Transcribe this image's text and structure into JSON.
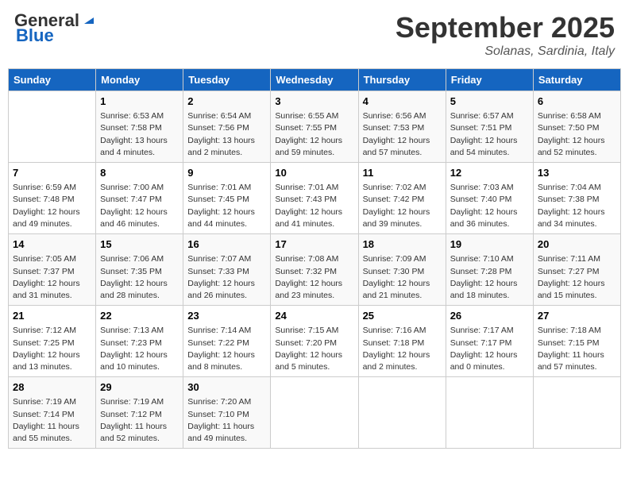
{
  "header": {
    "logo_line1": "General",
    "logo_line2": "Blue",
    "month": "September 2025",
    "location": "Solanas, Sardinia, Italy"
  },
  "weekdays": [
    "Sunday",
    "Monday",
    "Tuesday",
    "Wednesday",
    "Thursday",
    "Friday",
    "Saturday"
  ],
  "weeks": [
    [
      {
        "day": "",
        "sunrise": "",
        "sunset": "",
        "daylight": ""
      },
      {
        "day": "1",
        "sunrise": "Sunrise: 6:53 AM",
        "sunset": "Sunset: 7:58 PM",
        "daylight": "Daylight: 13 hours and 4 minutes."
      },
      {
        "day": "2",
        "sunrise": "Sunrise: 6:54 AM",
        "sunset": "Sunset: 7:56 PM",
        "daylight": "Daylight: 13 hours and 2 minutes."
      },
      {
        "day": "3",
        "sunrise": "Sunrise: 6:55 AM",
        "sunset": "Sunset: 7:55 PM",
        "daylight": "Daylight: 12 hours and 59 minutes."
      },
      {
        "day": "4",
        "sunrise": "Sunrise: 6:56 AM",
        "sunset": "Sunset: 7:53 PM",
        "daylight": "Daylight: 12 hours and 57 minutes."
      },
      {
        "day": "5",
        "sunrise": "Sunrise: 6:57 AM",
        "sunset": "Sunset: 7:51 PM",
        "daylight": "Daylight: 12 hours and 54 minutes."
      },
      {
        "day": "6",
        "sunrise": "Sunrise: 6:58 AM",
        "sunset": "Sunset: 7:50 PM",
        "daylight": "Daylight: 12 hours and 52 minutes."
      }
    ],
    [
      {
        "day": "7",
        "sunrise": "Sunrise: 6:59 AM",
        "sunset": "Sunset: 7:48 PM",
        "daylight": "Daylight: 12 hours and 49 minutes."
      },
      {
        "day": "8",
        "sunrise": "Sunrise: 7:00 AM",
        "sunset": "Sunset: 7:47 PM",
        "daylight": "Daylight: 12 hours and 46 minutes."
      },
      {
        "day": "9",
        "sunrise": "Sunrise: 7:01 AM",
        "sunset": "Sunset: 7:45 PM",
        "daylight": "Daylight: 12 hours and 44 minutes."
      },
      {
        "day": "10",
        "sunrise": "Sunrise: 7:01 AM",
        "sunset": "Sunset: 7:43 PM",
        "daylight": "Daylight: 12 hours and 41 minutes."
      },
      {
        "day": "11",
        "sunrise": "Sunrise: 7:02 AM",
        "sunset": "Sunset: 7:42 PM",
        "daylight": "Daylight: 12 hours and 39 minutes."
      },
      {
        "day": "12",
        "sunrise": "Sunrise: 7:03 AM",
        "sunset": "Sunset: 7:40 PM",
        "daylight": "Daylight: 12 hours and 36 minutes."
      },
      {
        "day": "13",
        "sunrise": "Sunrise: 7:04 AM",
        "sunset": "Sunset: 7:38 PM",
        "daylight": "Daylight: 12 hours and 34 minutes."
      }
    ],
    [
      {
        "day": "14",
        "sunrise": "Sunrise: 7:05 AM",
        "sunset": "Sunset: 7:37 PM",
        "daylight": "Daylight: 12 hours and 31 minutes."
      },
      {
        "day": "15",
        "sunrise": "Sunrise: 7:06 AM",
        "sunset": "Sunset: 7:35 PM",
        "daylight": "Daylight: 12 hours and 28 minutes."
      },
      {
        "day": "16",
        "sunrise": "Sunrise: 7:07 AM",
        "sunset": "Sunset: 7:33 PM",
        "daylight": "Daylight: 12 hours and 26 minutes."
      },
      {
        "day": "17",
        "sunrise": "Sunrise: 7:08 AM",
        "sunset": "Sunset: 7:32 PM",
        "daylight": "Daylight: 12 hours and 23 minutes."
      },
      {
        "day": "18",
        "sunrise": "Sunrise: 7:09 AM",
        "sunset": "Sunset: 7:30 PM",
        "daylight": "Daylight: 12 hours and 21 minutes."
      },
      {
        "day": "19",
        "sunrise": "Sunrise: 7:10 AM",
        "sunset": "Sunset: 7:28 PM",
        "daylight": "Daylight: 12 hours and 18 minutes."
      },
      {
        "day": "20",
        "sunrise": "Sunrise: 7:11 AM",
        "sunset": "Sunset: 7:27 PM",
        "daylight": "Daylight: 12 hours and 15 minutes."
      }
    ],
    [
      {
        "day": "21",
        "sunrise": "Sunrise: 7:12 AM",
        "sunset": "Sunset: 7:25 PM",
        "daylight": "Daylight: 12 hours and 13 minutes."
      },
      {
        "day": "22",
        "sunrise": "Sunrise: 7:13 AM",
        "sunset": "Sunset: 7:23 PM",
        "daylight": "Daylight: 12 hours and 10 minutes."
      },
      {
        "day": "23",
        "sunrise": "Sunrise: 7:14 AM",
        "sunset": "Sunset: 7:22 PM",
        "daylight": "Daylight: 12 hours and 8 minutes."
      },
      {
        "day": "24",
        "sunrise": "Sunrise: 7:15 AM",
        "sunset": "Sunset: 7:20 PM",
        "daylight": "Daylight: 12 hours and 5 minutes."
      },
      {
        "day": "25",
        "sunrise": "Sunrise: 7:16 AM",
        "sunset": "Sunset: 7:18 PM",
        "daylight": "Daylight: 12 hours and 2 minutes."
      },
      {
        "day": "26",
        "sunrise": "Sunrise: 7:17 AM",
        "sunset": "Sunset: 7:17 PM",
        "daylight": "Daylight: 12 hours and 0 minutes."
      },
      {
        "day": "27",
        "sunrise": "Sunrise: 7:18 AM",
        "sunset": "Sunset: 7:15 PM",
        "daylight": "Daylight: 11 hours and 57 minutes."
      }
    ],
    [
      {
        "day": "28",
        "sunrise": "Sunrise: 7:19 AM",
        "sunset": "Sunset: 7:14 PM",
        "daylight": "Daylight: 11 hours and 55 minutes."
      },
      {
        "day": "29",
        "sunrise": "Sunrise: 7:19 AM",
        "sunset": "Sunset: 7:12 PM",
        "daylight": "Daylight: 11 hours and 52 minutes."
      },
      {
        "day": "30",
        "sunrise": "Sunrise: 7:20 AM",
        "sunset": "Sunset: 7:10 PM",
        "daylight": "Daylight: 11 hours and 49 minutes."
      },
      {
        "day": "",
        "sunrise": "",
        "sunset": "",
        "daylight": ""
      },
      {
        "day": "",
        "sunrise": "",
        "sunset": "",
        "daylight": ""
      },
      {
        "day": "",
        "sunrise": "",
        "sunset": "",
        "daylight": ""
      },
      {
        "day": "",
        "sunrise": "",
        "sunset": "",
        "daylight": ""
      }
    ]
  ]
}
